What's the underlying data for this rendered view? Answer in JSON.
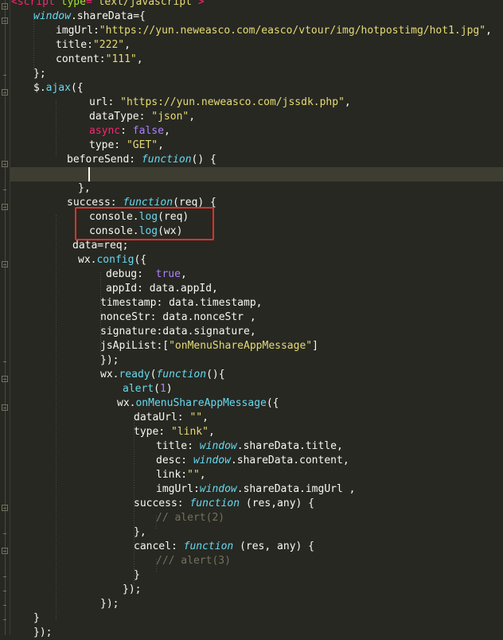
{
  "colors": {
    "background": "#272822",
    "highlight_box": "#e0302a",
    "keyword": "#f92672",
    "string": "#e6db74",
    "function": "#66d9ef",
    "number": "#ae81ff",
    "comment": "#75715e"
  },
  "code": {
    "l0": {
      "a": "<",
      "b": "script",
      "c": " type",
      "d": "=",
      "e": "\"text/javascript\"",
      "f": ">"
    },
    "l1": {
      "a": "window",
      "b": ".shareData={"
    },
    "l2": {
      "a": "imgUrl:",
      "b": "\"https://yun.neweasco.com/easco/vtour/img/hotpostimg/hot1.jpg\"",
      "c": ","
    },
    "l3": {
      "a": "title:",
      "b": "\"222\"",
      "c": ","
    },
    "l4": {
      "a": "content:",
      "b": "\"111\"",
      "c": ","
    },
    "l5": {
      "a": "};"
    },
    "l6": {
      "a": "$.",
      "b": "ajax",
      "c": "({"
    },
    "l7": {
      "a": "url: ",
      "b": "\"https://yun.neweasco.com/jssdk.php\"",
      "c": ","
    },
    "l8": {
      "a": "dataType: ",
      "b": "\"json\"",
      "c": ","
    },
    "l9": {
      "a": "async",
      "b": ": ",
      "c": "false",
      "d": ","
    },
    "l10": {
      "a": "type: ",
      "b": "\"GET\"",
      "c": ","
    },
    "l11": {
      "a": "beforeSend: ",
      "b": "function",
      "c": "() {"
    },
    "l12": {
      "a": ""
    },
    "l13": {
      "a": "},"
    },
    "l14": {
      "a": "success: ",
      "b": "function",
      "c": "(req) {"
    },
    "l15": {
      "a": "console.",
      "b": "log",
      "c": "(req)"
    },
    "l16": {
      "a": "console.",
      "b": "log",
      "c": "(wx)"
    },
    "l17": {
      "a": "data=req;"
    },
    "l18": {
      "a": "wx.",
      "b": "config",
      "c": "({"
    },
    "l19": {
      "a": "debug:  ",
      "b": "true",
      "c": ","
    },
    "l20": {
      "a": "appId: data.appId,"
    },
    "l21": {
      "a": "timestamp: data.timestamp,"
    },
    "l22": {
      "a": "nonceStr: data.nonceStr ,"
    },
    "l23": {
      "a": "signature:data.signature,"
    },
    "l24": {
      "a": "jsApiList:[",
      "b": "\"onMenuShareAppMessage\"",
      "c": "]"
    },
    "l25": {
      "a": "});"
    },
    "l26": {
      "a": "wx.",
      "b": "ready",
      "c": "(",
      "d": "function",
      "e": "(){"
    },
    "l27": {
      "a": "alert",
      "b": "(",
      "c": "1",
      "d": ")"
    },
    "l28": {
      "a": "wx.",
      "b": "onMenuShareAppMessage",
      "c": "({"
    },
    "l29": {
      "a": "dataUrl: ",
      "b": "\"\"",
      "c": ","
    },
    "l30": {
      "a": "type: ",
      "b": "\"link\"",
      "c": ","
    },
    "l31": {
      "a": "title: ",
      "b": "window",
      "c": ".shareData.title,"
    },
    "l32": {
      "a": "desc: ",
      "b": "window",
      "c": ".shareData.content,"
    },
    "l33": {
      "a": "link:",
      "b": "\"\"",
      "c": ","
    },
    "l34": {
      "a": "imgUrl:",
      "b": "window",
      "c": ".shareData.imgUrl ,"
    },
    "l35": {
      "a": "success: ",
      "b": "function",
      "c": " (res,any) {"
    },
    "l36": {
      "a": "// alert(2)"
    },
    "l37": {
      "a": "},"
    },
    "l38": {
      "a": "cancel: ",
      "b": "function",
      "c": " (res, any) {"
    },
    "l39": {
      "a": "/// alert(3)"
    },
    "l40": {
      "a": "}"
    },
    "l41": {
      "a": "});"
    },
    "l42": {
      "a": "});"
    },
    "l43": {
      "a": "}"
    },
    "l44": {
      "a": "});"
    }
  }
}
